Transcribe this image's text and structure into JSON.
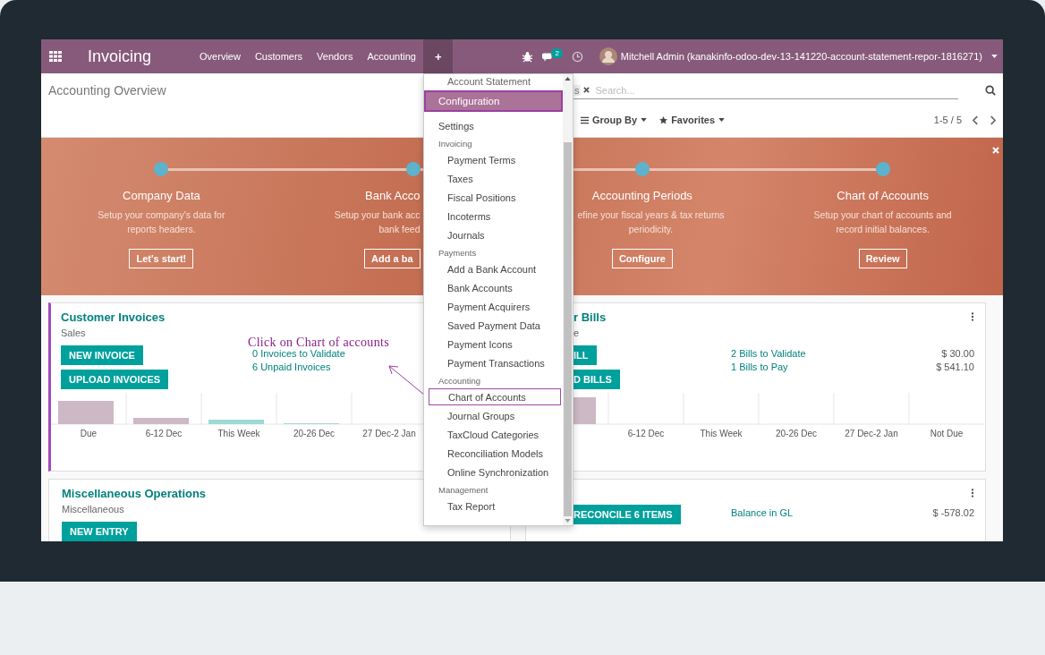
{
  "navbar": {
    "brand": "Invoicing",
    "menu": [
      {
        "label": "Overview",
        "selected": false
      },
      {
        "label": "Customers",
        "selected": false
      },
      {
        "label": "Vendors",
        "selected": false
      },
      {
        "label": "Accounting",
        "selected": false
      },
      {
        "label": "+",
        "selected": true
      }
    ],
    "chat_badge": "2",
    "user": "Mitchell Admin (kanakinfo-odoo-dev-13-141220-account-statement-repor-1816271)"
  },
  "control_panel": {
    "breadcrumb": "Accounting Overview",
    "search_facet": "s",
    "search_placeholder": "Search...",
    "group_by": "Group By",
    "favorites": "Favorites",
    "pager": "1-5 / 5"
  },
  "onboarding": {
    "steps": [
      {
        "title": "Company Data",
        "description": [
          "Setup your company's data for",
          "reports headers."
        ],
        "button": "Let's start!",
        "kind": "whole"
      },
      {
        "title": "Bank Acco",
        "description": [
          "Setup your bank acc",
          "bank feed"
        ],
        "button": "Add a ba",
        "kind": "tail"
      },
      {
        "title": "Accounting Periods",
        "description": [
          "efine your fiscal years & tax returns",
          "periodicity."
        ],
        "button": "Configure",
        "kind": "head"
      },
      {
        "title": "Chart of Accounts",
        "description": [
          "Setup your chart of accounts and",
          "record initial balances."
        ],
        "button": "Review",
        "kind": "whole"
      }
    ]
  },
  "dashboard": {
    "annotation": "Click on Chart of accounts",
    "cards": [
      {
        "title": "Customer Invoices",
        "subtitle": "Sales",
        "highlighted": true,
        "kind": "whole",
        "buttons": [
          "NEW INVOICE",
          "UPLOAD INVOICES"
        ],
        "stats": [
          {
            "label": "0 Invoices to Validate"
          },
          {
            "label": "6 Unpaid Invoices"
          }
        ],
        "chart_labels": [
          "Due",
          "6-12 Dec",
          "This Week",
          "20-26 Dec",
          "27 Dec-2 Jan"
        ]
      },
      {
        "title": "r Bills",
        "subtitle": "e",
        "highlighted": false,
        "kind": "head",
        "menu": true,
        "buttons": [
          "ILL",
          "D BILLS"
        ],
        "stats": [
          {
            "label": "2 Bills to Validate",
            "amount": "$ 30.00"
          },
          {
            "label": "1 Bills to Pay",
            "amount": "$ 541.10"
          }
        ],
        "chart_labels": [
          "6-12 Dec",
          "This Week",
          "20-26 Dec",
          "27 Dec-2 Jan",
          "Not Due"
        ]
      },
      {
        "title": "Miscellaneous Operations",
        "subtitle": "Miscellaneous",
        "highlighted": false,
        "kind": "whole",
        "buttons": [
          "NEW ENTRY"
        ]
      },
      {
        "highlighted": false,
        "kind": "head",
        "menu": true,
        "buttons": [
          "RECONCILE 6 ITEMS"
        ],
        "stats": [
          {
            "label": "Balance in GL",
            "amount": "$ -578.02"
          }
        ]
      }
    ]
  },
  "dropdown": {
    "above": "Account Statement",
    "header": {
      "label": "Configuration",
      "outlined": true
    },
    "items": [
      {
        "kind": "entry",
        "label": "Settings",
        "outlined": false
      },
      {
        "kind": "group",
        "label": "Invoicing",
        "children": [
          {
            "label": "Payment Terms",
            "outlined": false
          },
          {
            "label": "Taxes",
            "outlined": false
          },
          {
            "label": "Fiscal Positions",
            "outlined": false
          },
          {
            "label": "Incoterms",
            "outlined": false
          },
          {
            "label": "Journals",
            "outlined": false
          }
        ]
      },
      {
        "kind": "group",
        "label": "Payments",
        "children": [
          {
            "label": "Add a Bank Account",
            "outlined": false
          },
          {
            "label": "Bank Accounts",
            "outlined": false
          },
          {
            "label": "Payment Acquirers",
            "outlined": false
          },
          {
            "label": "Saved Payment Data",
            "outlined": false
          },
          {
            "label": "Payment Icons",
            "outlined": false
          },
          {
            "label": "Payment Transactions",
            "outlined": false
          }
        ]
      },
      {
        "kind": "group",
        "label": "Accounting",
        "children": [
          {
            "label": "Chart of Accounts",
            "outlined": true
          },
          {
            "label": "Journal Groups",
            "outlined": false
          },
          {
            "label": "TaxCloud Categories",
            "outlined": false
          },
          {
            "label": "Reconciliation Models",
            "outlined": false
          },
          {
            "label": "Online Synchronization",
            "outlined": false
          }
        ]
      },
      {
        "kind": "group",
        "label": "Management",
        "children": [
          {
            "label": "Tax Report",
            "outlined": false
          }
        ]
      }
    ]
  }
}
